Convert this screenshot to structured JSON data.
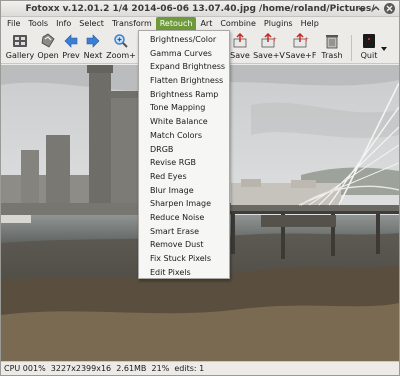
{
  "window": {
    "title": "Fotoxx v.12.01.2   1/4  2014-06-06 13.07.40.jpg  /home/roland/Pictures/"
  },
  "menubar": {
    "items": [
      {
        "label": "File"
      },
      {
        "label": "Tools"
      },
      {
        "label": "Info"
      },
      {
        "label": "Select"
      },
      {
        "label": "Transform"
      },
      {
        "label": "Retouch"
      },
      {
        "label": "Art"
      },
      {
        "label": "Combine"
      },
      {
        "label": "Plugins"
      },
      {
        "label": "Help"
      }
    ],
    "active": "Retouch"
  },
  "toolbar": {
    "gallery": "Gallery",
    "open": "Open",
    "prev": "Prev",
    "next": "Next",
    "zoom": "Zoom+",
    "save": "Save",
    "save_v": "Save+V",
    "save_f": "Save+F",
    "trash": "Trash",
    "quit": "Quit",
    "icons": [
      "gallery-icon",
      "open-icon",
      "prev-arrow-icon",
      "next-arrow-icon",
      "zoom-in-icon",
      "save-icon",
      "save-version-icon",
      "save-file-icon",
      "trash-icon",
      "quit-icon",
      "dropdown-arrow-icon"
    ]
  },
  "retouch_menu": {
    "items": [
      {
        "label": "Brightness/Color"
      },
      {
        "label": "Gamma Curves"
      },
      {
        "label": "Expand Brightness"
      },
      {
        "label": "Flatten Brightness"
      },
      {
        "label": "Brightness Ramp"
      },
      {
        "label": "Tone Mapping"
      },
      {
        "label": "White Balance"
      },
      {
        "label": "Match Colors"
      },
      {
        "label": "DRGB"
      },
      {
        "label": "Revise RGB"
      },
      {
        "label": "Red Eyes"
      },
      {
        "label": "Blur Image"
      },
      {
        "label": "Sharpen Image"
      },
      {
        "label": "Reduce Noise"
      },
      {
        "label": "Smart Erase"
      },
      {
        "label": "Remove Dust"
      },
      {
        "label": "Fix Stuck Pixels"
      },
      {
        "label": "Edit Pixels"
      }
    ]
  },
  "statusbar": {
    "text": "CPU 001%  3227x2399x16  2.61MB  21%  edits: 1"
  },
  "colors": {
    "menu_active": "#6f9a3c",
    "arrow_blue": "#3b7fd4",
    "save_red": "#c62828"
  }
}
